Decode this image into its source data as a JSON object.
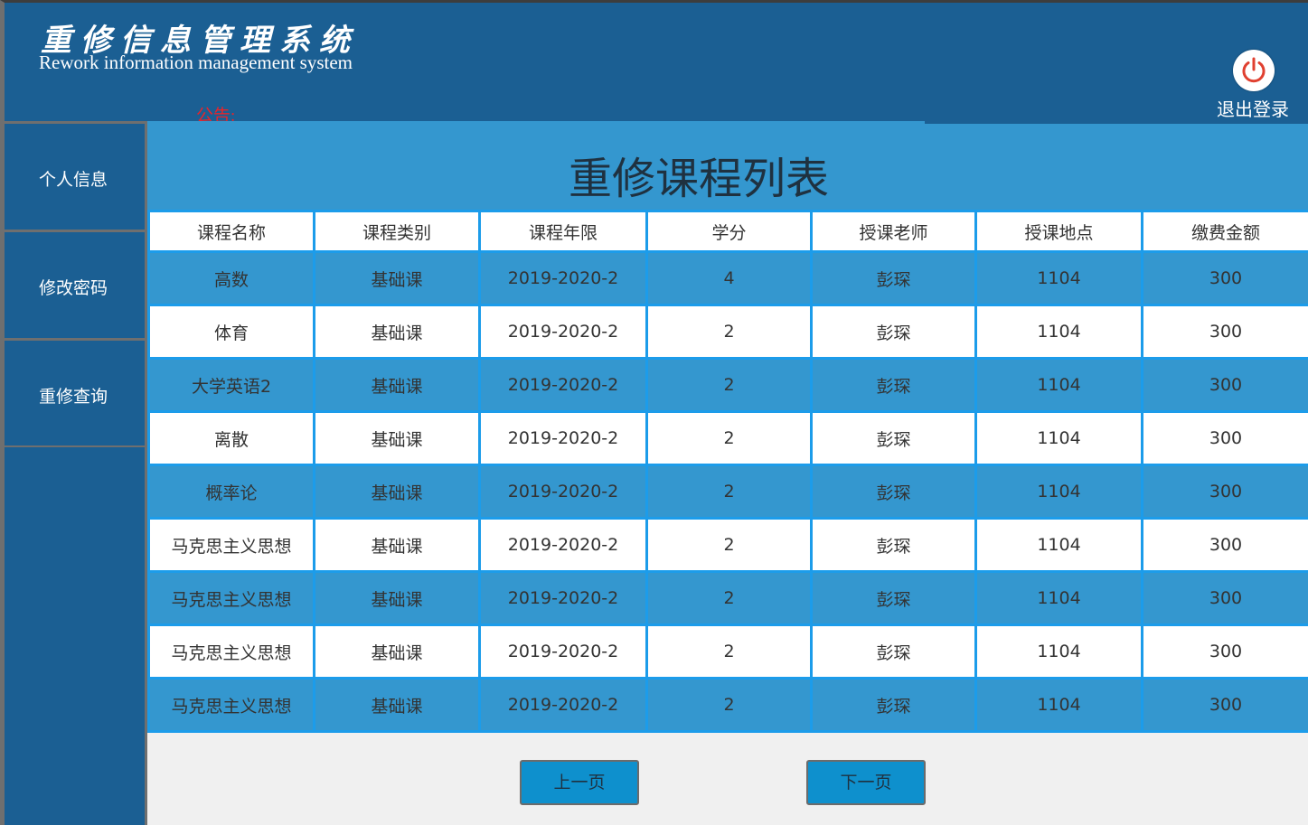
{
  "header": {
    "title_cn": "重修信息管理系统",
    "title_en": "Rework information management system",
    "notice_label": "公告:",
    "logout_label": "退出登录",
    "logout_icon": "power-icon"
  },
  "sidebar": {
    "items": [
      {
        "label": "个人信息"
      },
      {
        "label": "修改密码"
      },
      {
        "label": "重修查询"
      }
    ]
  },
  "main": {
    "title": "重修课程列表",
    "table": {
      "headers": [
        "课程名称",
        "课程类别",
        "课程年限",
        "学分",
        "授课老师",
        "授课地点",
        "缴费金额"
      ],
      "rows": [
        [
          "高数",
          "基础课",
          "2019-2020-2",
          "4",
          "彭琛",
          "1104",
          "300"
        ],
        [
          "体育",
          "基础课",
          "2019-2020-2",
          "2",
          "彭琛",
          "1104",
          "300"
        ],
        [
          "大学英语2",
          "基础课",
          "2019-2020-2",
          "2",
          "彭琛",
          "1104",
          "300"
        ],
        [
          "离散",
          "基础课",
          "2019-2020-2",
          "2",
          "彭琛",
          "1104",
          "300"
        ],
        [
          "概率论",
          "基础课",
          "2019-2020-2",
          "2",
          "彭琛",
          "1104",
          "300"
        ],
        [
          "马克思主义思想",
          "基础课",
          "2019-2020-2",
          "2",
          "彭琛",
          "1104",
          "300"
        ],
        [
          "马克思主义思想",
          "基础课",
          "2019-2020-2",
          "2",
          "彭琛",
          "1104",
          "300"
        ],
        [
          "马克思主义思想",
          "基础课",
          "2019-2020-2",
          "2",
          "彭琛",
          "1104",
          "300"
        ],
        [
          "马克思主义思想",
          "基础课",
          "2019-2020-2",
          "2",
          "彭琛",
          "1104",
          "300"
        ]
      ]
    },
    "pager": {
      "prev_label": "上一页",
      "next_label": "下一页"
    }
  },
  "colors": {
    "header_bg": "#1b5f93",
    "content_bg": "#3497cf",
    "table_border": "#1c9cea",
    "notice": "#e8242a",
    "button_bg": "#0e90cd"
  }
}
